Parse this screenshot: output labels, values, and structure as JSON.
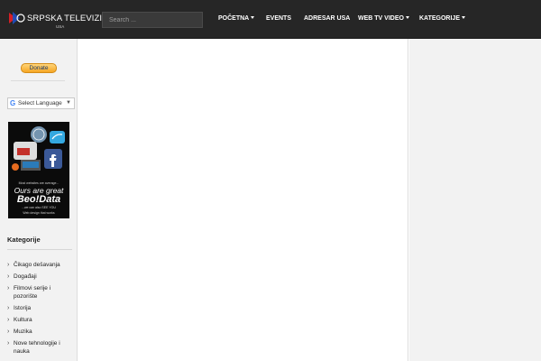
{
  "header": {
    "logo": {
      "title": "SRPSKA TELEVIZIJA",
      "subtitle": "USA"
    },
    "search": {
      "placeholder": "Search ...",
      "value": ""
    },
    "nav": [
      {
        "label": "POČETNA",
        "dropdown": true
      },
      {
        "label": "EVENTS",
        "dropdown": false
      },
      {
        "label": "ADRESAR USA",
        "dropdown": false
      },
      {
        "label": "WEB TV VIDEO",
        "dropdown": true
      },
      {
        "label": "KATEGORIJE",
        "dropdown": true
      }
    ]
  },
  "sidebar": {
    "donate_label": "Donate",
    "language": {
      "label": "Select Language",
      "g": "G",
      "arrow": "▼"
    },
    "ad": {
      "line1": "Most websites are average...",
      "line2": "Ours are great",
      "line3": "Beo!Data",
      "line4": "...we can also SEE YOU",
      "line5": "Web design that works"
    },
    "categories_heading": "Kategorije",
    "categories": [
      "Čikago dešavanja",
      "Događaji",
      "Filmovi serije i pozorište",
      "Istorija",
      "Kultura",
      "Muzika",
      "Nove tehnologije i nauka"
    ]
  },
  "colors": {
    "header_bg": "#262626",
    "sidebar_bg": "#f2f2f2",
    "donate_gold": "#f6a623"
  }
}
